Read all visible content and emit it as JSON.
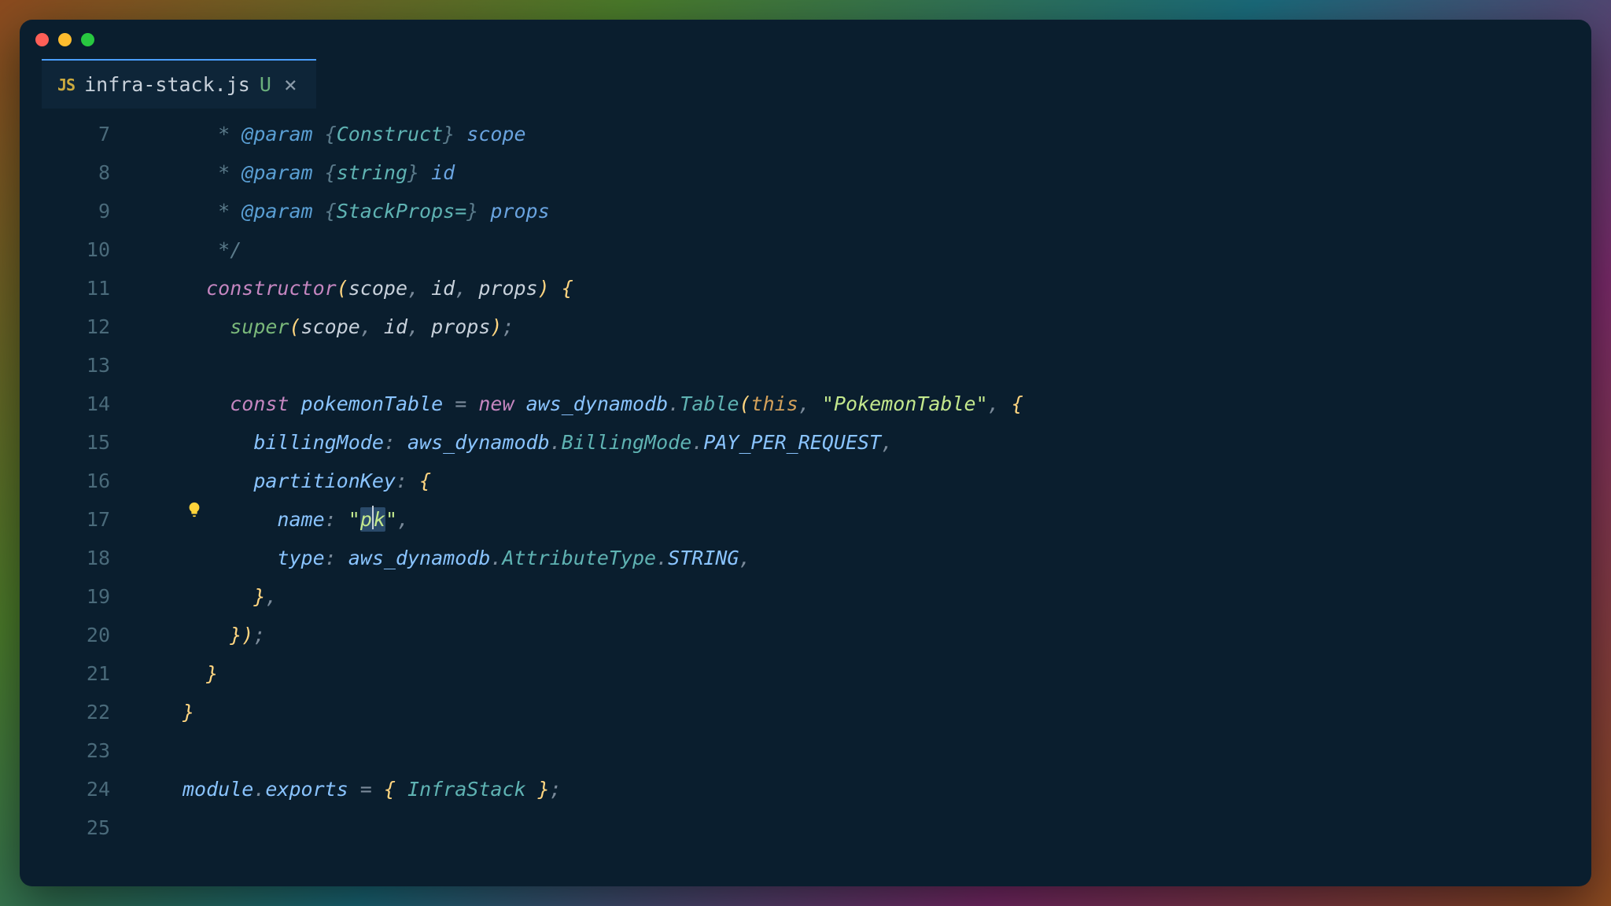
{
  "window": {
    "traffic_lights": [
      "close",
      "minimize",
      "maximize"
    ]
  },
  "tab": {
    "icon_label": "JS",
    "filename": "infra-stack.js",
    "modified_indicator": "U",
    "close_label": "×"
  },
  "gutter": {
    "start": 7,
    "end": 25,
    "lightbulb_line": 17
  },
  "code": {
    "lines": [
      {
        "n": 7,
        "indent": 3,
        "tokens": [
          [
            "comment",
            "* "
          ],
          [
            "tag",
            "@param"
          ],
          [
            "comment",
            " {"
          ],
          [
            "type",
            "Construct"
          ],
          [
            "comment",
            "} "
          ],
          [
            "param",
            "scope"
          ]
        ]
      },
      {
        "n": 8,
        "indent": 3,
        "tokens": [
          [
            "comment",
            "* "
          ],
          [
            "tag",
            "@param"
          ],
          [
            "comment",
            " {"
          ],
          [
            "type",
            "string"
          ],
          [
            "comment",
            "} "
          ],
          [
            "param",
            "id"
          ]
        ]
      },
      {
        "n": 9,
        "indent": 3,
        "tokens": [
          [
            "comment",
            "* "
          ],
          [
            "tag",
            "@param"
          ],
          [
            "comment",
            " {"
          ],
          [
            "type",
            "StackProps="
          ],
          [
            "comment",
            "} "
          ],
          [
            "param",
            "props"
          ]
        ]
      },
      {
        "n": 10,
        "indent": 3,
        "tokens": [
          [
            "comment",
            "*/"
          ]
        ]
      },
      {
        "n": 11,
        "indent": 2,
        "tokens": [
          [
            "keyword",
            "constructor"
          ],
          [
            "paren",
            "("
          ],
          [
            "var",
            "scope"
          ],
          [
            "punct",
            ", "
          ],
          [
            "var",
            "id"
          ],
          [
            "punct",
            ", "
          ],
          [
            "var",
            "props"
          ],
          [
            "paren",
            ")"
          ],
          [
            "white",
            " "
          ],
          [
            "brace",
            "{"
          ]
        ]
      },
      {
        "n": 12,
        "indent": 4,
        "tokens": [
          [
            "func",
            "super"
          ],
          [
            "paren",
            "("
          ],
          [
            "var",
            "scope"
          ],
          [
            "punct",
            ", "
          ],
          [
            "var",
            "id"
          ],
          [
            "punct",
            ", "
          ],
          [
            "var",
            "props"
          ],
          [
            "paren",
            ")"
          ],
          [
            "punct",
            ";"
          ]
        ]
      },
      {
        "n": 13,
        "indent": 0,
        "tokens": []
      },
      {
        "n": 14,
        "indent": 4,
        "tokens": [
          [
            "const",
            "const"
          ],
          [
            "white",
            " "
          ],
          [
            "ident",
            "pokemonTable"
          ],
          [
            "white",
            " "
          ],
          [
            "punct",
            "="
          ],
          [
            "white",
            " "
          ],
          [
            "new",
            "new"
          ],
          [
            "white",
            " "
          ],
          [
            "module",
            "aws_dynamodb"
          ],
          [
            "punct",
            "."
          ],
          [
            "class",
            "Table"
          ],
          [
            "paren",
            "("
          ],
          [
            "this",
            "this"
          ],
          [
            "punct",
            ", "
          ],
          [
            "string",
            "\"PokemonTable\""
          ],
          [
            "punct",
            ", "
          ],
          [
            "brace",
            "{"
          ]
        ]
      },
      {
        "n": 15,
        "indent": 6,
        "tokens": [
          [
            "prop",
            "billingMode"
          ],
          [
            "punct",
            ": "
          ],
          [
            "module",
            "aws_dynamodb"
          ],
          [
            "punct",
            "."
          ],
          [
            "class",
            "BillingMode"
          ],
          [
            "punct",
            "."
          ],
          [
            "enum",
            "PAY_PER_REQUEST"
          ],
          [
            "punct",
            ","
          ]
        ]
      },
      {
        "n": 16,
        "indent": 6,
        "tokens": [
          [
            "prop",
            "partitionKey"
          ],
          [
            "punct",
            ": "
          ],
          [
            "brace",
            "{"
          ]
        ]
      },
      {
        "n": 17,
        "indent": 8,
        "tokens": [
          [
            "prop",
            "name"
          ],
          [
            "punct",
            ": "
          ],
          [
            "string",
            "\""
          ],
          [
            "sel",
            "pk"
          ],
          [
            "string",
            "\""
          ],
          [
            "punct",
            ","
          ]
        ]
      },
      {
        "n": 18,
        "indent": 8,
        "tokens": [
          [
            "prop",
            "type"
          ],
          [
            "punct",
            ": "
          ],
          [
            "module",
            "aws_dynamodb"
          ],
          [
            "punct",
            "."
          ],
          [
            "class",
            "AttributeType"
          ],
          [
            "punct",
            "."
          ],
          [
            "enum",
            "STRING"
          ],
          [
            "punct",
            ","
          ]
        ]
      },
      {
        "n": 19,
        "indent": 6,
        "tokens": [
          [
            "brace",
            "}"
          ],
          [
            "punct",
            ","
          ]
        ]
      },
      {
        "n": 20,
        "indent": 4,
        "tokens": [
          [
            "brace",
            "}"
          ],
          [
            "paren",
            ")"
          ],
          [
            "punct",
            ";"
          ]
        ]
      },
      {
        "n": 21,
        "indent": 2,
        "tokens": [
          [
            "brace",
            "}"
          ]
        ]
      },
      {
        "n": 22,
        "indent": 0,
        "tokens": [
          [
            "brace",
            "}"
          ]
        ]
      },
      {
        "n": 23,
        "indent": 0,
        "tokens": []
      },
      {
        "n": 24,
        "indent": 0,
        "tokens": [
          [
            "module",
            "module"
          ],
          [
            "punct",
            "."
          ],
          [
            "prop",
            "exports"
          ],
          [
            "white",
            " "
          ],
          [
            "punct",
            "="
          ],
          [
            "white",
            " "
          ],
          [
            "brace",
            "{"
          ],
          [
            "white",
            " "
          ],
          [
            "class",
            "InfraStack"
          ],
          [
            "white",
            " "
          ],
          [
            "brace",
            "}"
          ],
          [
            "punct",
            ";"
          ]
        ]
      },
      {
        "n": 25,
        "indent": 0,
        "tokens": []
      }
    ]
  }
}
